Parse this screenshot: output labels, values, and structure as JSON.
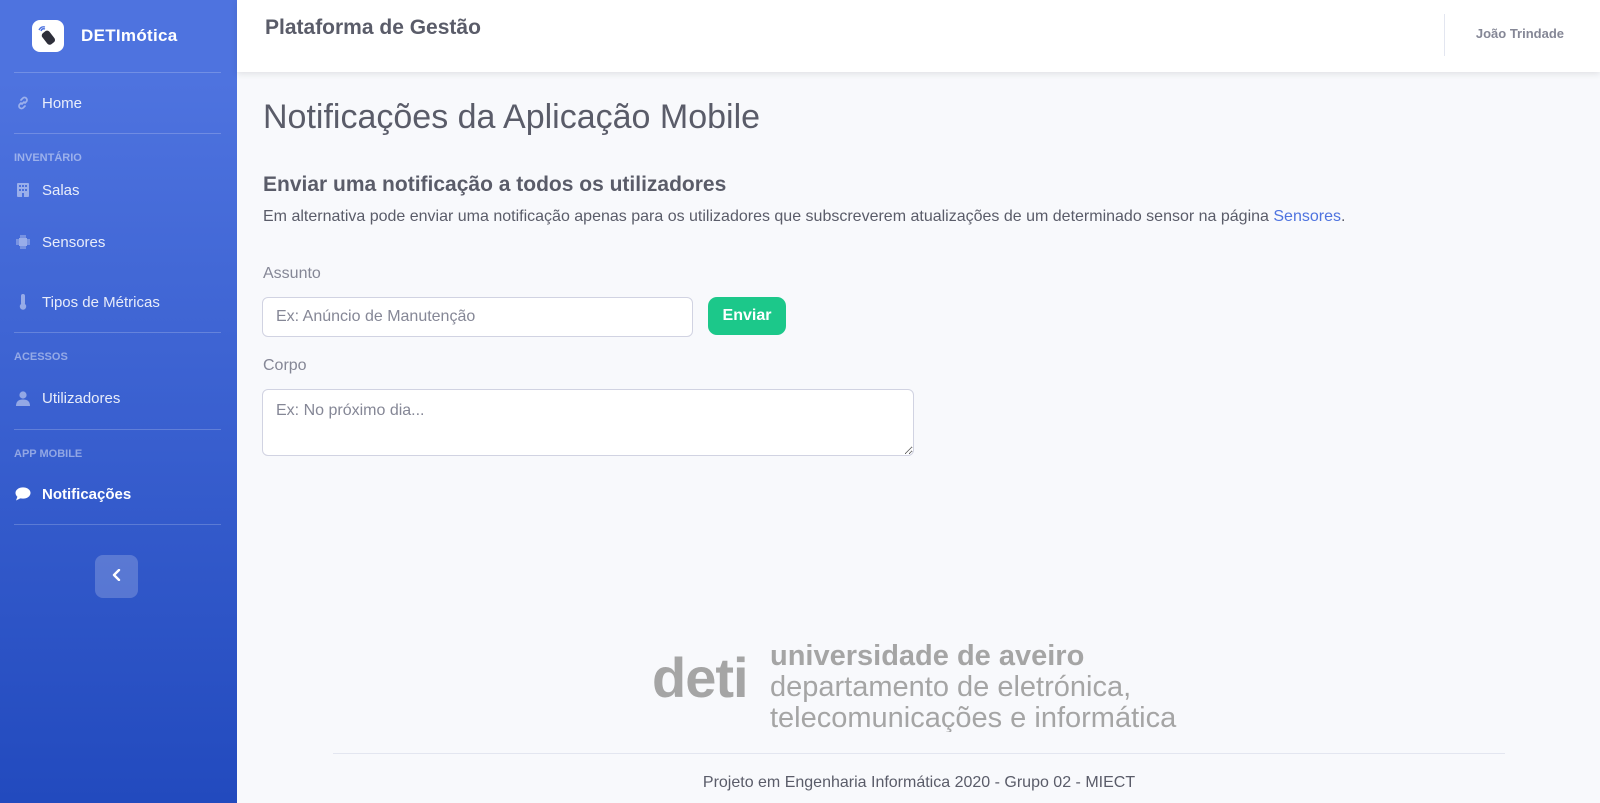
{
  "sidebar": {
    "brand": "DETImótica",
    "items": [
      {
        "label": "Home",
        "icon": "link-icon"
      },
      {
        "label": "Salas",
        "icon": "building-icon"
      },
      {
        "label": "Sensores",
        "icon": "chip-icon"
      },
      {
        "label": "Tipos de Métricas",
        "icon": "thermometer-icon"
      },
      {
        "label": "Utilizadores",
        "icon": "user-icon"
      },
      {
        "label": "Notificações",
        "icon": "comment-icon",
        "active": true
      }
    ],
    "sections": {
      "inventario": "INVENTÁRIO",
      "acessos": "ACESSOS",
      "app_mobile": "APP MOBILE"
    }
  },
  "topbar": {
    "title": "Plataforma de Gestão",
    "user": "João Trindade"
  },
  "main": {
    "page_title": "Notificações da Aplicação Mobile",
    "subtitle": "Enviar uma notificação a todos os utilizadores",
    "description_prefix": "Em alternativa pode enviar uma notificação apenas para os utilizadores que subscreverem atualizações de um determinado sensor na página ",
    "description_link": "Sensores",
    "description_suffix": ".",
    "subject_label": "Assunto",
    "subject_placeholder": "Ex: Anúncio de Manutenção",
    "subject_value": "",
    "send_label": "Enviar",
    "body_label": "Corpo",
    "body_placeholder": "Ex: No próximo dia..."
  },
  "footer": {
    "logo_word": "deti",
    "logo_line1": "universidade de aveiro",
    "logo_line2": "departamento de eletrónica,",
    "logo_line3": "telecomunicações e informática",
    "text": "Projeto em Engenharia Informática 2020 - Grupo 02 - MIECT"
  },
  "colors": {
    "primary": "#4e73df",
    "success": "#1cc88a",
    "text": "#5a5c69"
  }
}
